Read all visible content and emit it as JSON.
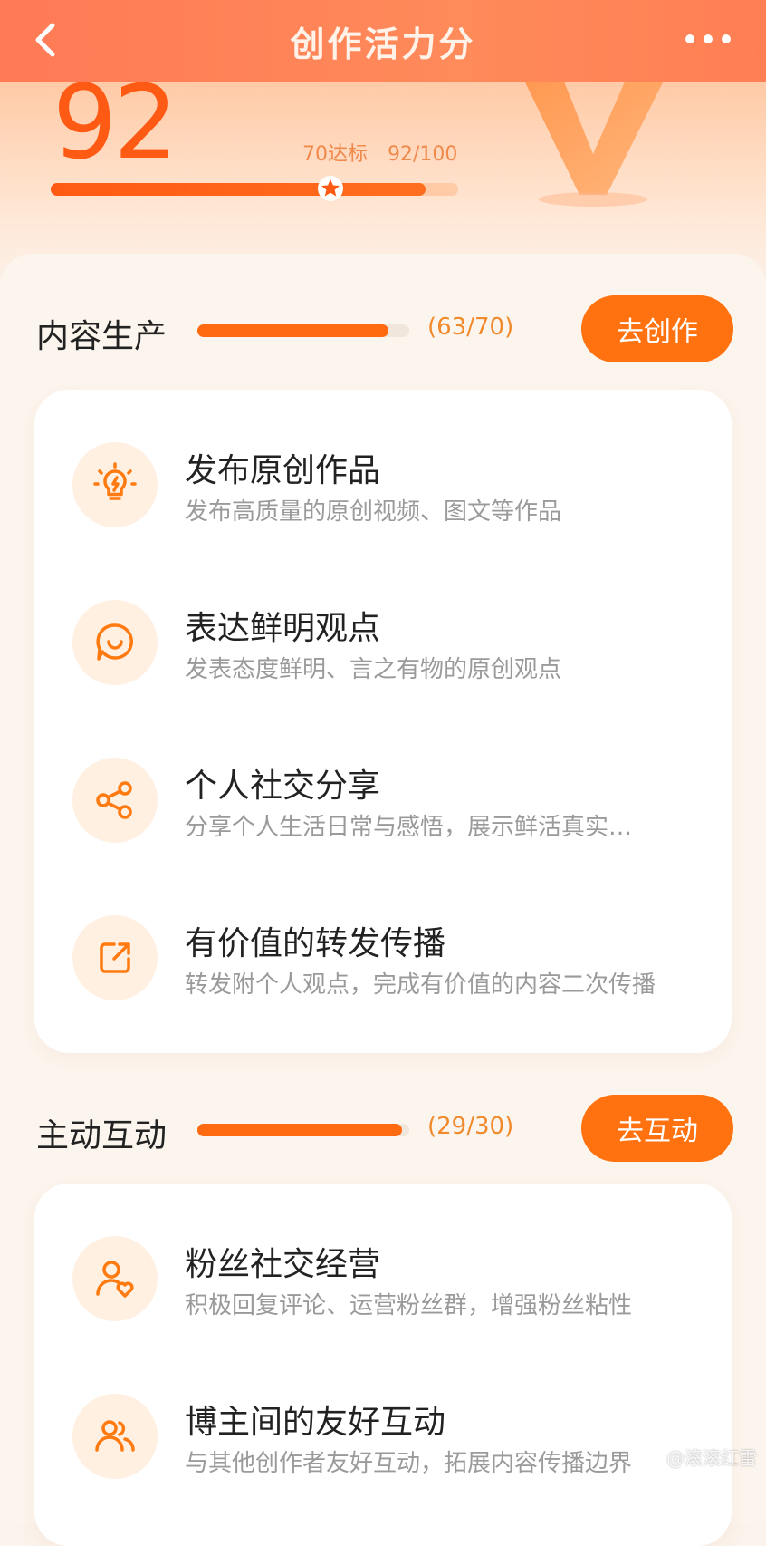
{
  "header": {
    "title": "创作活力分"
  },
  "score": {
    "value": "92",
    "target_label": "70达标",
    "progress_text": "92/100",
    "progress_fraction": 0.92,
    "target_fraction": 0.7
  },
  "sections": [
    {
      "title": "内容生产",
      "count": "(63/70)",
      "progress_fraction": 0.9,
      "button": "去创作",
      "items": [
        {
          "icon": "lightbulb-icon",
          "title": "发布原创作品",
          "desc": "发布高质量的原创视频、图文等作品"
        },
        {
          "icon": "chat-smile-icon",
          "title": "表达鲜明观点",
          "desc": "发表态度鲜明、言之有物的原创观点"
        },
        {
          "icon": "share-icon",
          "title": "个人社交分享",
          "desc": "分享个人生活日常与感悟，展示鲜活真实…"
        },
        {
          "icon": "forward-icon",
          "title": "有价值的转发传播",
          "desc": "转发附个人观点，完成有价值的内容二次传播"
        }
      ]
    },
    {
      "title": "主动互动",
      "count": "(29/30)",
      "progress_fraction": 0.967,
      "button": "去互动",
      "items": [
        {
          "icon": "fan-heart-icon",
          "title": "粉丝社交经营",
          "desc": "积极回复评论、运营粉丝群，增强粉丝粘性"
        },
        {
          "icon": "users-icon",
          "title": "博主间的友好互动",
          "desc": "与其他创作者友好互动，拓展内容传播边界"
        }
      ]
    }
  ],
  "watermark": "@滚滚红雷",
  "colors": {
    "accent": "#ff720f",
    "header": "#ff7a55",
    "score": "#ff5a14"
  }
}
